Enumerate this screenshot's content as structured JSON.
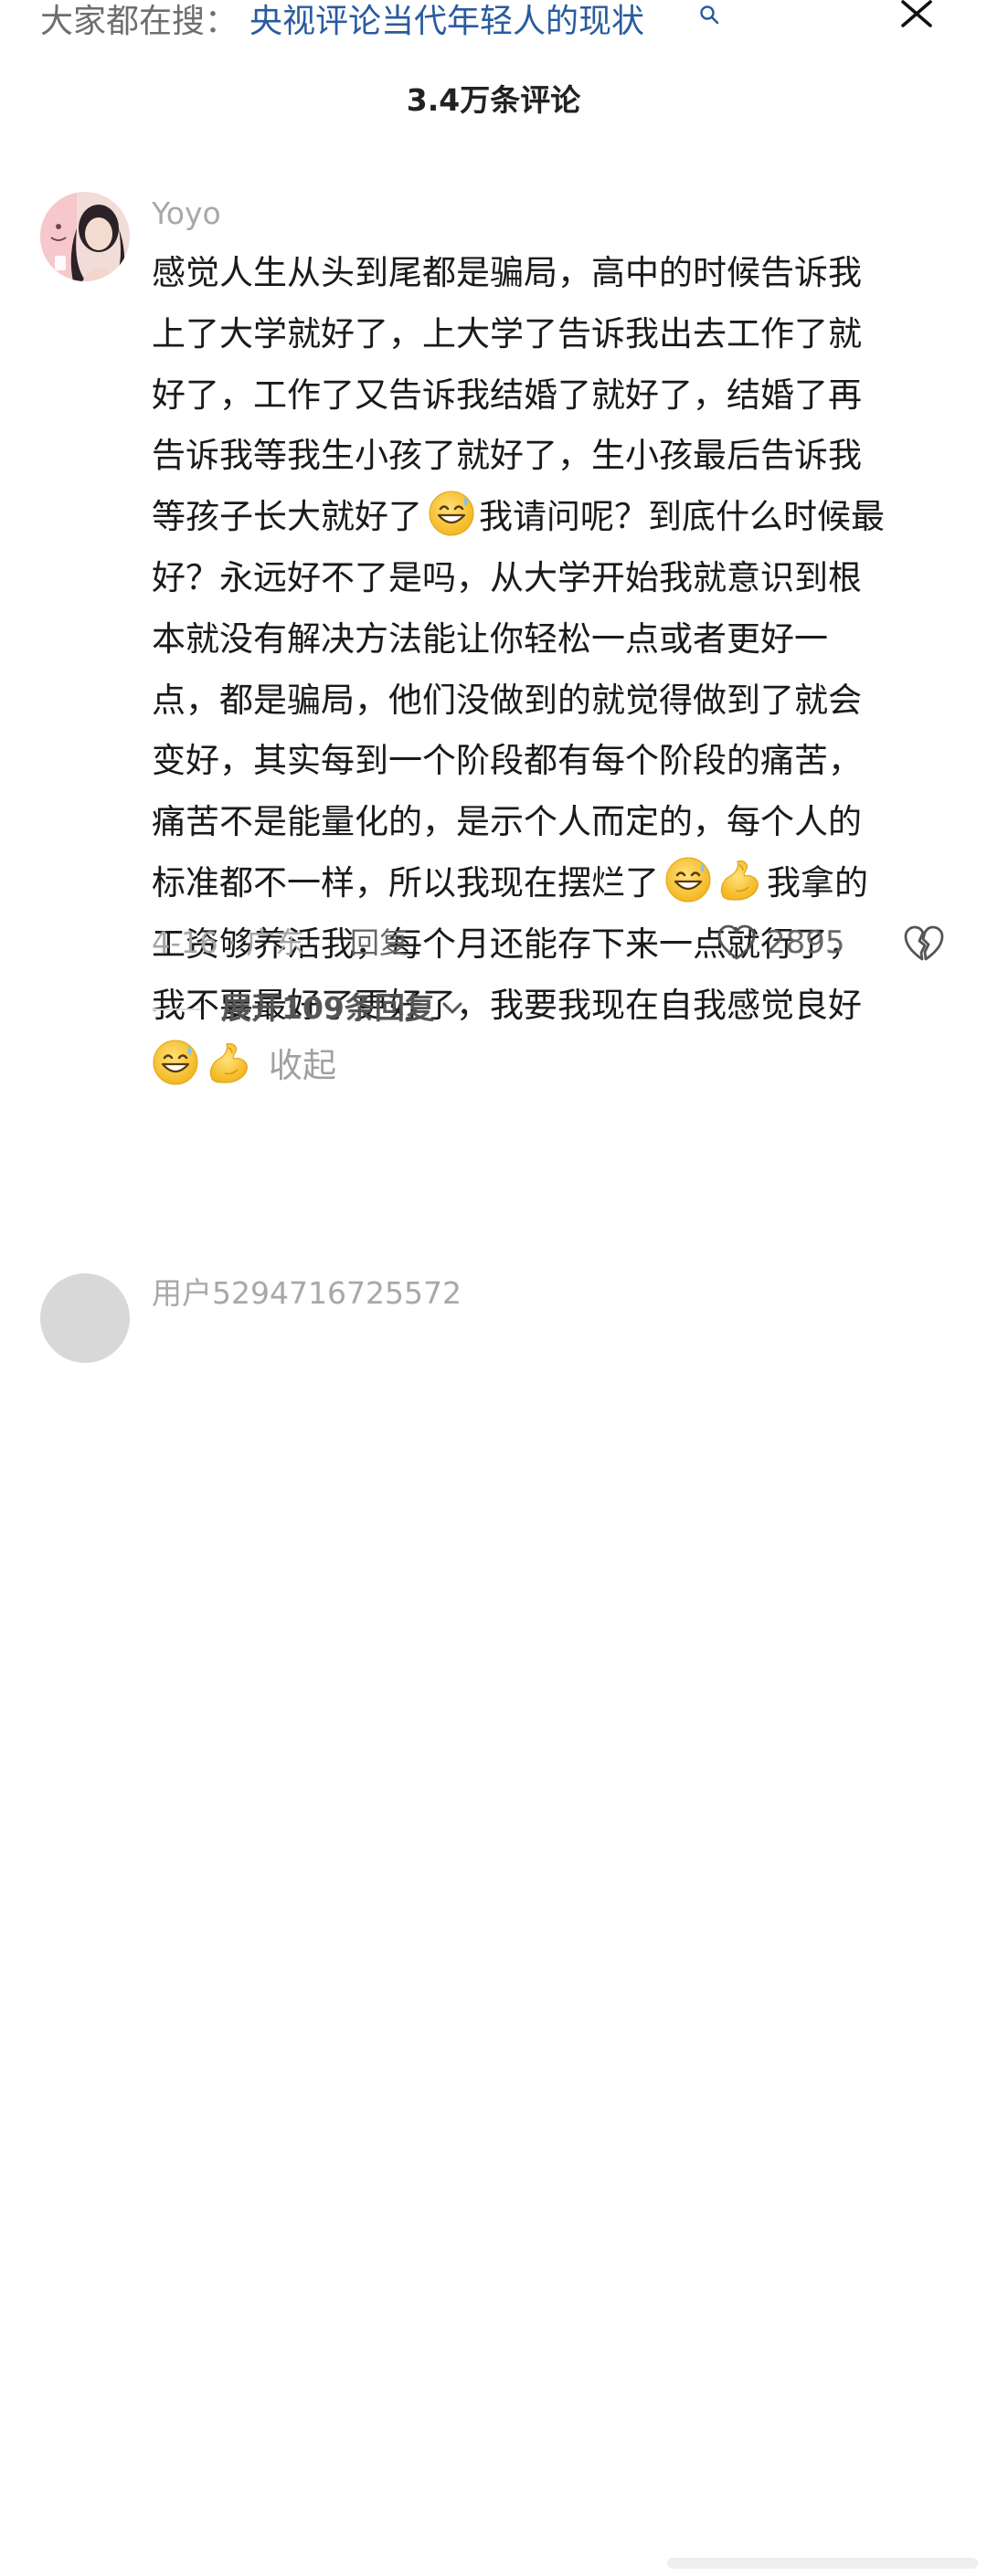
{
  "topbar": {
    "search_prefix": "大家都在搜：",
    "search_query": "央视评论当代年轻人的现状"
  },
  "header": {
    "comment_count_title": "3.4万条评论"
  },
  "comment": {
    "username": "Yoyo",
    "lines": [
      {
        "text": "感觉人生从头到尾都是骗局，高中的时候告诉我"
      },
      {
        "text": "上了大学就好了，上大学了告诉我出去工作了就"
      },
      {
        "text": "好了，工作了又告诉我结婚了就好了，结婚了再"
      },
      {
        "text": "告诉我等我生小孩了就好了，生小孩最后告诉我"
      },
      {
        "text_a": "等孩子长大就好了",
        "emoji": "grin-sweat-emoji",
        "text_b": "我请问呢？到底什么时候最"
      },
      {
        "text": "好？永远好不了是吗，从大学开始我就意识到根"
      },
      {
        "text": "本就没有解决方法能让你轻松一点或者更好一"
      },
      {
        "text": "点，都是骗局，他们没做到的就觉得做到了就会"
      },
      {
        "text": "变好，其实每到一个阶段都有每个阶段的痛苦，"
      },
      {
        "text": "痛苦不是能量化的，是示个人而定的，每个人的"
      },
      {
        "text_a": "标准都不一样，所以我现在摆烂了",
        "emojis": [
          "grin-sweat-emoji",
          "flexed-biceps-emoji"
        ],
        "text_b": "我拿的"
      },
      {
        "text": "工资够养活我，每个月还能存下来一点就行了，"
      },
      {
        "text": "我不要最好了更好了，我要我现在自我感觉良好"
      }
    ],
    "last_line_emojis": [
      "grin-sweat-emoji",
      "flexed-biceps-emoji"
    ],
    "collapse_label": "收起",
    "date_location": "4-16 · 广东",
    "reply_label": "回复",
    "like_count": "2895",
    "expand_replies_label": "展开109条回复"
  },
  "next_comment": {
    "username": "用户5294716725572"
  },
  "colors": {
    "link_blue": "#2a5b9e",
    "muted_gray": "#a6a6a6",
    "text_dark": "#1a1a1a",
    "emoji_yellow": "#f7c52b"
  },
  "icons": {
    "search": "search-icon",
    "close": "close-icon",
    "like": "heart-outline-icon",
    "dislike": "broken-heart-icon",
    "expand": "chevron-down-icon"
  }
}
